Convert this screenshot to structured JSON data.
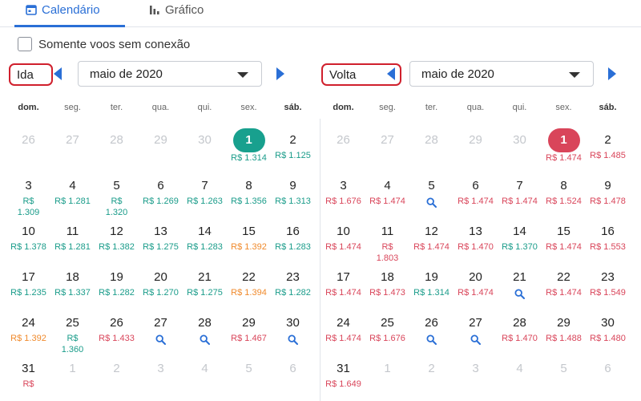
{
  "tabs": {
    "calendar_label": "Calendário",
    "chart_label": "Gráfico"
  },
  "filter": {
    "nonstop_label": "Somente voos sem conexão",
    "nonstop_checked": false
  },
  "colors": {
    "accent": "#2a6fd6",
    "cheap": "#1a9c8a",
    "expensive": "#d9455a",
    "medium": "#f08a2c",
    "highlight_border": "#d0202d"
  },
  "weekdays": [
    "dom.",
    "seg.",
    "ter.",
    "qua.",
    "qui.",
    "sex.",
    "sáb."
  ],
  "outbound": {
    "label": "Ida",
    "month": "maio de 2020",
    "weeks": [
      [
        {
          "day": "26",
          "muted": true
        },
        {
          "day": "27",
          "muted": true
        },
        {
          "day": "28",
          "muted": true
        },
        {
          "day": "29",
          "muted": true
        },
        {
          "day": "30",
          "muted": true
        },
        {
          "day": "1",
          "selected": "teal",
          "price": "R$ 1.314",
          "tone": "green"
        },
        {
          "day": "2",
          "price": "R$ 1.125",
          "tone": "green"
        }
      ],
      [
        {
          "day": "3",
          "price": "R$\n1.309",
          "tone": "green"
        },
        {
          "day": "4",
          "price": "R$ 1.281",
          "tone": "green"
        },
        {
          "day": "5",
          "price": "R$\n1.320",
          "tone": "green"
        },
        {
          "day": "6",
          "price": "R$ 1.269",
          "tone": "green"
        },
        {
          "day": "7",
          "price": "R$ 1.263",
          "tone": "green"
        },
        {
          "day": "8",
          "price": "R$ 1.356",
          "tone": "green"
        },
        {
          "day": "9",
          "price": "R$ 1.313",
          "tone": "green"
        }
      ],
      [
        {
          "day": "10",
          "price": "R$ 1.378",
          "tone": "green"
        },
        {
          "day": "11",
          "price": "R$ 1.281",
          "tone": "green"
        },
        {
          "day": "12",
          "price": "R$ 1.382",
          "tone": "green"
        },
        {
          "day": "13",
          "price": "R$ 1.275",
          "tone": "green"
        },
        {
          "day": "14",
          "price": "R$ 1.283",
          "tone": "green"
        },
        {
          "day": "15",
          "price": "R$ 1.392",
          "tone": "orange"
        },
        {
          "day": "16",
          "price": "R$ 1.283",
          "tone": "green"
        }
      ],
      [
        {
          "day": "17",
          "price": "R$ 1.235",
          "tone": "green"
        },
        {
          "day": "18",
          "price": "R$ 1.337",
          "tone": "green"
        },
        {
          "day": "19",
          "price": "R$ 1.282",
          "tone": "green"
        },
        {
          "day": "20",
          "price": "R$ 1.270",
          "tone": "green"
        },
        {
          "day": "21",
          "price": "R$ 1.275",
          "tone": "green"
        },
        {
          "day": "22",
          "price": "R$ 1.394",
          "tone": "orange"
        },
        {
          "day": "23",
          "price": "R$ 1.282",
          "tone": "green"
        }
      ],
      [
        {
          "day": "24",
          "price": "R$ 1.392",
          "tone": "orange"
        },
        {
          "day": "25",
          "price": "R$\n1.360",
          "tone": "green"
        },
        {
          "day": "26",
          "price": "R$ 1.433",
          "tone": "red"
        },
        {
          "day": "27",
          "search": true
        },
        {
          "day": "28",
          "search": true
        },
        {
          "day": "29",
          "price": "R$ 1.467",
          "tone": "red"
        },
        {
          "day": "30",
          "search": true
        }
      ],
      [
        {
          "day": "31",
          "price": "R$",
          "tone": "red"
        },
        {
          "day": "1",
          "muted": true
        },
        {
          "day": "2",
          "muted": true
        },
        {
          "day": "3",
          "muted": true
        },
        {
          "day": "4",
          "muted": true
        },
        {
          "day": "5",
          "muted": true
        },
        {
          "day": "6",
          "muted": true
        }
      ]
    ]
  },
  "return": {
    "label": "Volta",
    "month": "maio de 2020",
    "weeks": [
      [
        {
          "day": "26",
          "muted": true
        },
        {
          "day": "27",
          "muted": true
        },
        {
          "day": "28",
          "muted": true
        },
        {
          "day": "29",
          "muted": true
        },
        {
          "day": "30",
          "muted": true
        },
        {
          "day": "1",
          "selected": "red",
          "price": "R$ 1.474",
          "tone": "red"
        },
        {
          "day": "2",
          "price": "R$ 1.485",
          "tone": "red"
        }
      ],
      [
        {
          "day": "3",
          "price": "R$ 1.676",
          "tone": "red"
        },
        {
          "day": "4",
          "price": "R$ 1.474",
          "tone": "red"
        },
        {
          "day": "5",
          "search": true
        },
        {
          "day": "6",
          "price": "R$ 1.474",
          "tone": "red"
        },
        {
          "day": "7",
          "price": "R$ 1.474",
          "tone": "red"
        },
        {
          "day": "8",
          "price": "R$ 1.524",
          "tone": "red"
        },
        {
          "day": "9",
          "price": "R$ 1.478",
          "tone": "red"
        }
      ],
      [
        {
          "day": "10",
          "price": "R$ 1.474",
          "tone": "red"
        },
        {
          "day": "11",
          "price": "R$\n1.803",
          "tone": "red"
        },
        {
          "day": "12",
          "price": "R$ 1.474",
          "tone": "red"
        },
        {
          "day": "13",
          "price": "R$ 1.470",
          "tone": "red"
        },
        {
          "day": "14",
          "price": "R$ 1.370",
          "tone": "green"
        },
        {
          "day": "15",
          "price": "R$ 1.474",
          "tone": "red"
        },
        {
          "day": "16",
          "price": "R$ 1.553",
          "tone": "red"
        }
      ],
      [
        {
          "day": "17",
          "price": "R$ 1.474",
          "tone": "red"
        },
        {
          "day": "18",
          "price": "R$ 1.473",
          "tone": "red"
        },
        {
          "day": "19",
          "price": "R$ 1.314",
          "tone": "green"
        },
        {
          "day": "20",
          "price": "R$ 1.474",
          "tone": "red"
        },
        {
          "day": "21",
          "search": true
        },
        {
          "day": "22",
          "price": "R$ 1.474",
          "tone": "red"
        },
        {
          "day": "23",
          "price": "R$ 1.549",
          "tone": "red"
        }
      ],
      [
        {
          "day": "24",
          "price": "R$ 1.474",
          "tone": "red"
        },
        {
          "day": "25",
          "price": "R$ 1.676",
          "tone": "red"
        },
        {
          "day": "26",
          "search": true
        },
        {
          "day": "27",
          "search": true
        },
        {
          "day": "28",
          "price": "R$ 1.470",
          "tone": "red"
        },
        {
          "day": "29",
          "price": "R$ 1.488",
          "tone": "red"
        },
        {
          "day": "30",
          "price": "R$ 1.480",
          "tone": "red"
        }
      ],
      [
        {
          "day": "31",
          "price": "R$ 1.649",
          "tone": "red"
        },
        {
          "day": "1",
          "muted": true
        },
        {
          "day": "2",
          "muted": true
        },
        {
          "day": "3",
          "muted": true
        },
        {
          "day": "4",
          "muted": true
        },
        {
          "day": "5",
          "muted": true
        },
        {
          "day": "6",
          "muted": true
        }
      ]
    ]
  }
}
